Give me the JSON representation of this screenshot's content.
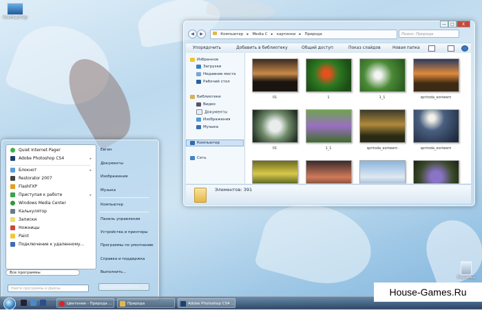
{
  "desktop": {
    "computer_icon_label": "Компьютер",
    "recycle_icon_label": "Корзина"
  },
  "explorer": {
    "address": [
      "Компьютер",
      "Media C",
      "картинки",
      "Природа"
    ],
    "search_placeholder": "Поиск: Природа",
    "window_controls": [
      "—",
      "□",
      "X"
    ],
    "toolbar": [
      "Упорядочить",
      "Добавить в библиотеку",
      "Общий доступ",
      "Показ слайдов",
      "Новая папка"
    ],
    "nav": {
      "favorites": "Избранное",
      "downloads": "Загрузки",
      "recent": "Недавние места",
      "desktop": "Рабочий стол",
      "libraries": "Библиотеки",
      "video": "Видео",
      "documents": "Документы",
      "images": "Изображения",
      "music": "Музыка",
      "computer": "Компьютер",
      "network": "Сеть"
    },
    "thumbnails": [
      "01",
      "1",
      "1_1",
      "spriroda_eoriwern",
      "01",
      "1_1",
      "spriroda_eoriwern",
      "spriroda_eoriwern",
      "",
      "",
      "",
      ""
    ],
    "status": "Элементов: 391"
  },
  "start_menu": {
    "programs": [
      "Quiet Internet Pager",
      "Adobe Photoshop CS4",
      "Блокнот",
      "Restorator 2007",
      "FlashFXP",
      "Приступая к работе",
      "Windows Media Center",
      "Калькулятор",
      "Записки",
      "Ножницы",
      "Paint",
      "Подключение к удаленному..."
    ],
    "all_programs": "Все программы",
    "search_placeholder": "Найти программы и файлы",
    "right_links": [
      "Евген",
      "Документы",
      "Изображения",
      "Музыка",
      "Компьютер",
      "Панель управления",
      "Устройства и принтеры",
      "Программы по умолчанию",
      "Справка и поддержка",
      "Выполнить..."
    ],
    "shutdown": "Завершение работы"
  },
  "taskbar": {
    "tasks": [
      "Цветение - Природа ...",
      "Природа",
      "Adobe Photoshop CS4 ..."
    ]
  },
  "watermark": "House-Games.Ru"
}
